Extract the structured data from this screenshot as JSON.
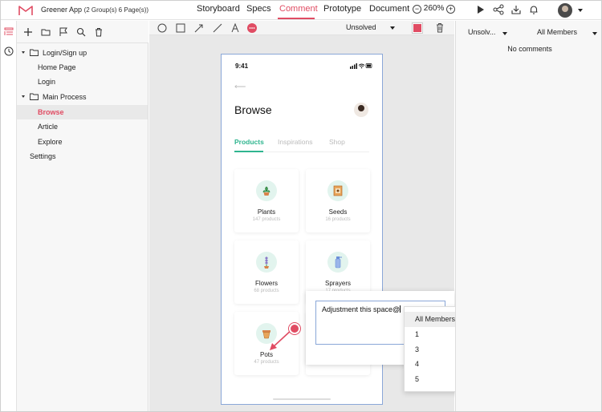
{
  "app": {
    "title": "Greener App",
    "subtitle": "(2 Group(s) 6 Page(s))",
    "brand_color": "#e04c63"
  },
  "nav": {
    "tabs": [
      "Storyboard",
      "Specs",
      "Comment",
      "Prototype",
      "Document"
    ],
    "active_tab": "Comment",
    "zoom": "260%",
    "zoom_out": "−",
    "zoom_in": "+"
  },
  "layers": {
    "items": [
      {
        "label": "Login/Sign up",
        "type": "group"
      },
      {
        "label": "Home Page",
        "type": "page"
      },
      {
        "label": "Login",
        "type": "page"
      },
      {
        "label": "Main Process",
        "type": "group"
      },
      {
        "label": "Browse",
        "type": "page",
        "selected": true
      },
      {
        "label": "Article",
        "type": "page"
      },
      {
        "label": "Explore",
        "type": "page"
      },
      {
        "label": "Settings",
        "type": "page"
      }
    ]
  },
  "canvas_toolbar": {
    "status": "Unsolved",
    "color": "#e04c63"
  },
  "phone": {
    "time": "9:41",
    "back": "⟵",
    "title": "Browse",
    "tabs": [
      "Products",
      "Inspirations",
      "Shop"
    ],
    "active_tab": "Products",
    "accent": "#2fb58f",
    "cards": [
      {
        "name": "Plants",
        "count": "147 products",
        "icon": "potted-plant-icon"
      },
      {
        "name": "Seeds",
        "count": "16 products",
        "icon": "seed-packet-icon"
      },
      {
        "name": "Flowers",
        "count": "68 products",
        "icon": "flower-icon"
      },
      {
        "name": "Sprayers",
        "count": "17 products",
        "icon": "sprayer-icon"
      },
      {
        "name": "Pots",
        "count": "47 products",
        "icon": "pot-icon"
      }
    ]
  },
  "comment": {
    "input_value": "Adjustment this space@",
    "mention_options": [
      "All Members",
      "1",
      "3",
      "4",
      "5"
    ],
    "highlighted": "All Members"
  },
  "right_panel": {
    "status_filter": "Unsolv...",
    "member_filter": "All Members",
    "empty_text": "No comments"
  }
}
